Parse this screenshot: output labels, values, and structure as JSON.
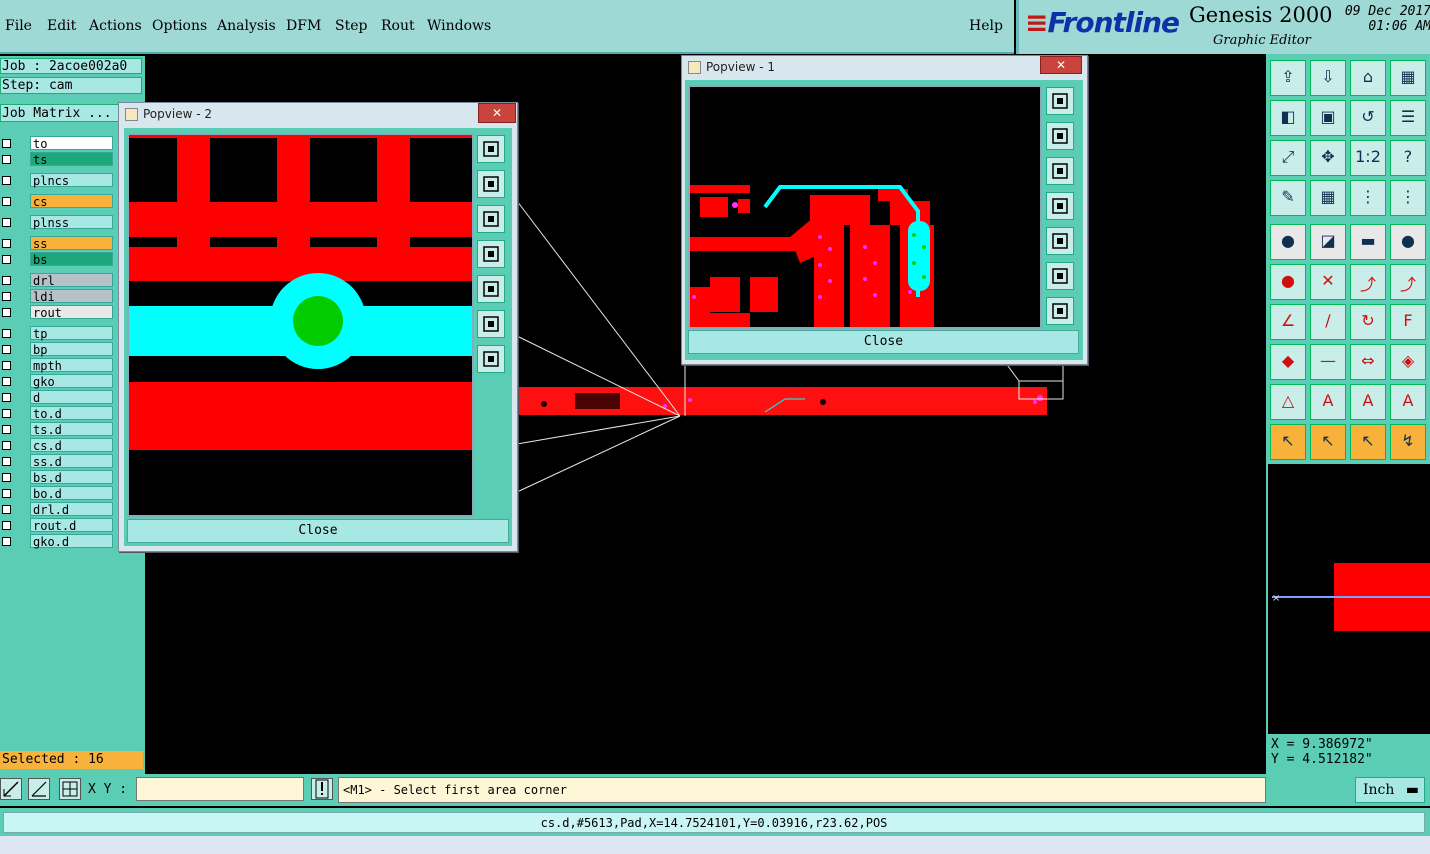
{
  "menu": {
    "items": [
      "File",
      "Edit",
      "Actions",
      "Options",
      "Analysis",
      "DFM",
      "Step",
      "Rout",
      "Windows"
    ],
    "help": "Help"
  },
  "brand": {
    "logo": "Frontline",
    "product": "Genesis 2000",
    "subtitle": "Graphic Editor",
    "date": "09 Dec 2017",
    "time": "01:06 AM"
  },
  "job": {
    "job_line": "Job : 2acoe002a0",
    "step_line": "Step: cam",
    "matrix_label": "Job Matrix ..."
  },
  "layers": [
    {
      "name": "to",
      "color": "#ffffff"
    },
    {
      "name": "ts",
      "color": "#1ea77a"
    },
    {
      "name": "plncs",
      "color": "#a8e8e4"
    },
    {
      "name": "cs",
      "color": "#f8b23c"
    },
    {
      "name": "plnss",
      "color": "#a8e8e4"
    },
    {
      "name": "ss",
      "color": "#f8b23c"
    },
    {
      "name": "bs",
      "color": "#1ea77a"
    },
    {
      "name": "drl",
      "color": "#b8c0c8"
    },
    {
      "name": "ldi",
      "color": "#b8c0c8"
    },
    {
      "name": "rout",
      "color": "#e8e8e8"
    },
    {
      "name": "tp",
      "color": "#a8e8e4"
    },
    {
      "name": "bp",
      "color": "#a8e8e4"
    },
    {
      "name": "mpth",
      "color": "#a8e8e4"
    },
    {
      "name": "gko",
      "color": "#a8e8e4"
    },
    {
      "name": "d",
      "color": "#a8e8e4"
    },
    {
      "name": "to.d",
      "color": "#a8e8e4"
    },
    {
      "name": "ts.d",
      "color": "#a8e8e4"
    },
    {
      "name": "cs.d",
      "color": "#a8e8e4"
    },
    {
      "name": "ss.d",
      "color": "#a8e8e4"
    },
    {
      "name": "bs.d",
      "color": "#a8e8e4"
    },
    {
      "name": "bo.d",
      "color": "#a8e8e4"
    },
    {
      "name": "drl.d",
      "color": "#a8e8e4"
    },
    {
      "name": "rout.d",
      "color": "#a8e8e4"
    },
    {
      "name": "gko.d",
      "color": "#a8e8e4"
    }
  ],
  "popview1": {
    "title": "Popview - 1",
    "close": "Close",
    "x": "✕"
  },
  "popview2": {
    "title": "Popview - 2",
    "close": "Close",
    "x": "✕"
  },
  "selected": "Selected : 16",
  "xy_label": "X Y :",
  "xy_value": "",
  "prompt": "<M1> - Select first area corner",
  "units": "Inch",
  "coords": {
    "x": "X = 9.386972\"",
    "y": "Y = 4.512182\""
  },
  "status": "cs.d,#5613,Pad,X=14.7524101,Y=0.03916,r23.62,POS",
  "colors": {
    "accent": "#5ccdb5",
    "copper": "#ff0000",
    "trace": "#00ffff",
    "pad": "#00cc00",
    "highlight": "#f8b23c"
  }
}
